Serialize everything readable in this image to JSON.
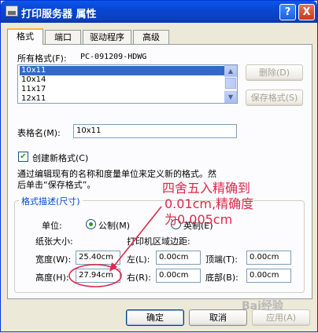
{
  "window": {
    "title": "打印服务器 属性",
    "help_btn": "?",
    "close_btn": "X"
  },
  "tabs": [
    "格式",
    "端口",
    "驱动程序",
    "高级"
  ],
  "forms": {
    "label": "所有格式(F):",
    "server_name": "PC-091209-HDWG",
    "items": [
      "10x11",
      "10x14",
      "11x17",
      "12x11"
    ],
    "selected_index": 0,
    "delete_button": "删除(D)",
    "save_button": "保存格式(S)"
  },
  "form_name": {
    "label": "表格名(M):",
    "value": "10x11"
  },
  "create_new": {
    "label": "创建新格式(C)",
    "checked": true
  },
  "description": {
    "line1": "通过编辑现有的名称和度量单位来定义新的格式。然",
    "line2": "后单击“保存格式”。"
  },
  "group": {
    "title": "格式描述(尺寸)",
    "unit_label": "单位:",
    "metric_label": "公制(M)",
    "english_label": "英制(E)",
    "unit_selected": "metric",
    "paper_size_label": "纸张大小:",
    "margin_label": "打印机区域边距:",
    "width_label": "宽度(W):",
    "width_value": "25.40cm",
    "height_label": "高度(H):",
    "height_value": "27.94cm",
    "left_label": "左(L):",
    "left_value": "0.00cm",
    "right_label": "右(R):",
    "right_value": "0.00cm",
    "top_label": "顶端(T):",
    "top_value": "0.00cm",
    "bottom_label": "底部(B):",
    "bottom_value": "0.00cm"
  },
  "annotation": {
    "line1": "四舍五入精确到",
    "line2": "0.01cm,精确度",
    "line3": "为0.005cm",
    "color": "#e0284a"
  },
  "buttons": {
    "ok": "确定",
    "cancel": "取消",
    "apply": "应用(A)"
  },
  "watermark": "Bai经验"
}
